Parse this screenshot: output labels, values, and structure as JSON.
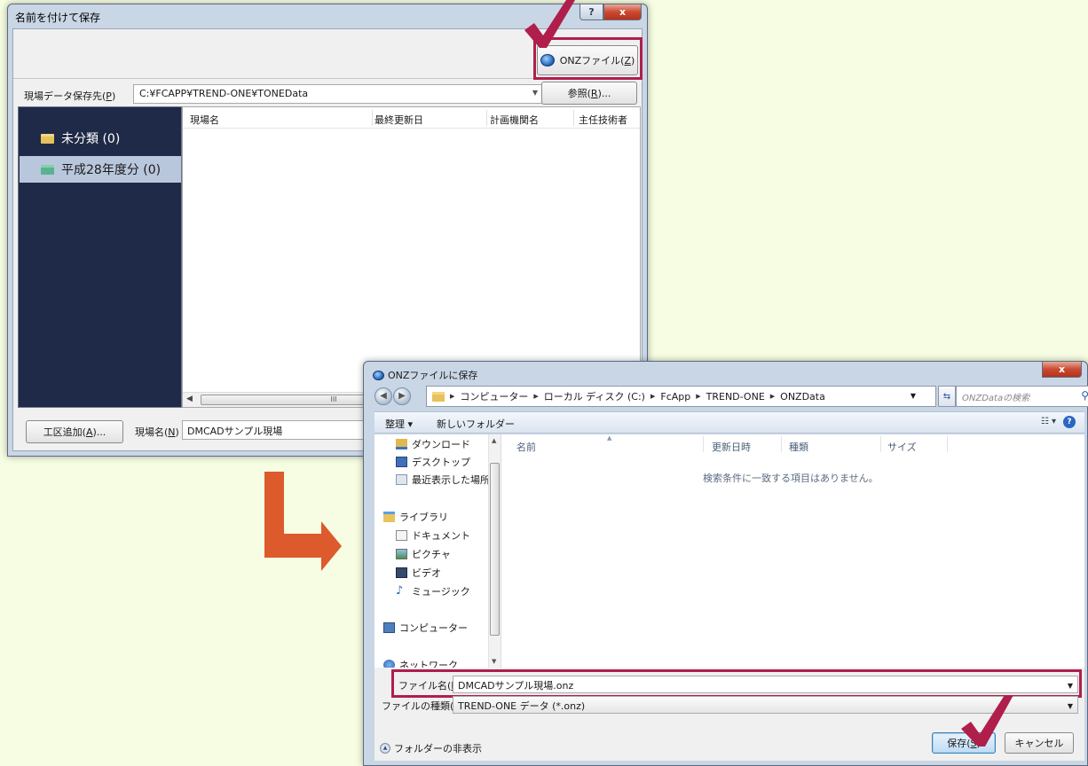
{
  "dialog1": {
    "title": "名前を付けて保存",
    "help_glyph": "?",
    "close_glyph": "x",
    "onz_button": {
      "label": "ONZファイル(",
      "key": "Z",
      "suffix": ")"
    },
    "path_label": {
      "text": "現場データ保存先(",
      "key": "P",
      "suffix": ")"
    },
    "path_value": "C:¥FCAPP¥TREND-ONE¥TONEData",
    "browse_button": {
      "label": "参照(",
      "key": "R",
      "suffix": ")..."
    },
    "nav_items": [
      {
        "label": "未分類 (0)",
        "icon": "folder-icon"
      },
      {
        "label": "平成28年度分 (0)",
        "icon": "folder-teal-icon"
      }
    ],
    "columns": [
      "現場名",
      "最終更新日",
      "計画機関名",
      "主任技術者"
    ],
    "scroll_thumb_glyph": "III",
    "add_work_button": {
      "label": "工区追加(",
      "key": "A",
      "suffix": ")..."
    },
    "site_name_label": {
      "text": "現場名(",
      "key": "N",
      "suffix": ")"
    },
    "site_name_value": "DMCADサンプル現場"
  },
  "dialog2": {
    "title": "ONZファイルに保存",
    "close_glyph": "x",
    "breadcrumb": [
      "コンピューター",
      "ローカル ディスク (C:)",
      "FcApp",
      "TREND-ONE",
      "ONZData"
    ],
    "search_placeholder": "ONZDataの検索",
    "organize_label": "整理 ▾",
    "new_folder_label": "新しいフォルダー",
    "tree": [
      {
        "label": "ダウンロード",
        "icon": "download-icon",
        "level": 1
      },
      {
        "label": "デスクトップ",
        "icon": "desktop-icon",
        "level": 1
      },
      {
        "label": "最近表示した場所",
        "icon": "recent-places-icon",
        "level": 1
      },
      {
        "label": "ライブラリ",
        "icon": "library-icon",
        "level": 0
      },
      {
        "label": "ドキュメント",
        "icon": "documents-icon",
        "level": 1
      },
      {
        "label": "ピクチャ",
        "icon": "pictures-icon",
        "level": 1
      },
      {
        "label": "ビデオ",
        "icon": "video-icon",
        "level": 1
      },
      {
        "label": "ミュージック",
        "icon": "music-icon",
        "level": 1
      },
      {
        "label": "コンピューター",
        "icon": "computer-icon",
        "level": 0
      },
      {
        "label": "ネットワーク",
        "icon": "network-icon",
        "level": 0
      }
    ],
    "columns": [
      "名前",
      "更新日時",
      "種類",
      "サイズ"
    ],
    "empty_message": "検索条件に一致する項目はありません。",
    "file_name_label": {
      "text": "ファイル名(",
      "key": "N",
      "suffix": "):"
    },
    "file_name_value": "DMCADサンプル現場.onz",
    "file_type_label": {
      "text": "ファイルの種類(",
      "key": "T",
      "suffix": "):"
    },
    "file_type_value": "TREND-ONE データ (*.onz)",
    "hide_folders_label": "フォルダーの非表示",
    "save_button": {
      "label": "保存(",
      "key": "S",
      "suffix": ")"
    },
    "cancel_button": "キャンセル"
  },
  "colors": {
    "page_background": "#f6fde2",
    "highlight_border": "#b01e4c",
    "check_mark": "#b01e4c",
    "arrow": "#dd5a2c",
    "nav_pane": "#1e2a47"
  }
}
